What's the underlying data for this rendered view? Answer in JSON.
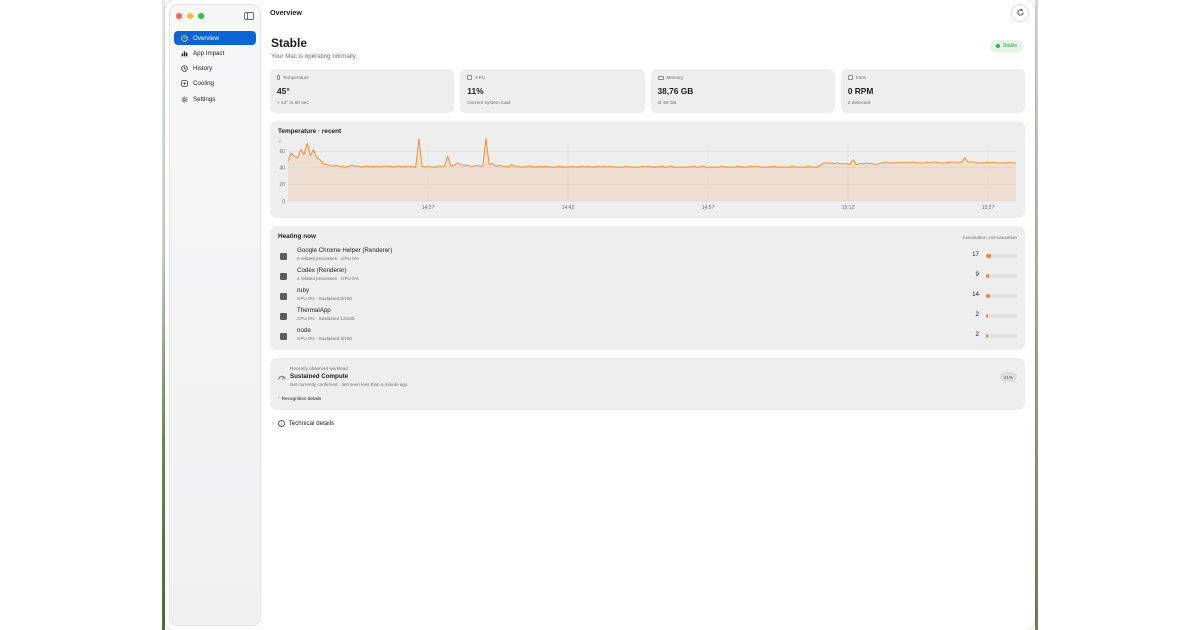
{
  "window": {
    "title": "Overview",
    "accent_color": "#0a64d6"
  },
  "sidebar": {
    "items": [
      {
        "label": "Overview",
        "icon": "gauge-icon",
        "active": true
      },
      {
        "label": "App Impact",
        "icon": "bar-chart-icon",
        "active": false
      },
      {
        "label": "History",
        "icon": "clock-icon",
        "active": false
      },
      {
        "label": "Cooling",
        "icon": "fan-icon",
        "active": false
      },
      {
        "label": "Settings",
        "icon": "gear-icon",
        "active": false
      }
    ]
  },
  "status": {
    "title": "Stable",
    "subtitle": "Your Mac is operating normally.",
    "badge": "Stable",
    "badge_color": "#2f9e45"
  },
  "cards": [
    {
      "label": "Temperature",
      "value": "45°",
      "sub": "≈ 44° in 60 sec"
    },
    {
      "label": "CPU",
      "value": "11%",
      "sub": "Current system load"
    },
    {
      "label": "Memory",
      "value": "38,76 GB",
      "sub": "of 48 GB"
    },
    {
      "label": "Fans",
      "value": "0 RPM",
      "sub": "2 detected"
    }
  ],
  "chart_panel": {
    "title": "Temperature · recent"
  },
  "chart_data": {
    "type": "area",
    "title": "Temperature · recent",
    "ylabel": "",
    "ylim": [
      0,
      70
    ],
    "yticks": [
      0,
      20,
      40,
      60
    ],
    "xtick_labels": [
      "14:27",
      "14:42",
      "14:57",
      "15:12",
      "15:27"
    ],
    "y_unit_label": "°C",
    "series": [
      {
        "color": "#f08a24",
        "values": [
          48,
          58,
          54,
          52,
          62,
          56,
          70,
          55,
          62,
          52,
          50,
          45,
          44,
          43,
          42,
          43,
          42,
          42,
          41,
          42,
          43,
          42,
          42,
          41,
          42,
          42,
          41,
          42,
          42,
          41,
          42,
          42,
          42,
          41,
          42,
          42,
          41,
          42,
          42,
          41,
          41,
          75,
          42,
          41,
          42,
          41,
          41,
          42,
          42,
          42,
          54,
          42,
          43,
          46,
          44,
          43,
          43,
          42,
          42,
          43,
          42,
          42,
          76,
          44,
          45,
          42,
          43,
          42,
          42,
          41,
          44,
          42,
          42,
          41,
          41,
          42,
          42,
          41,
          41,
          42,
          41,
          42,
          41,
          41,
          41,
          42,
          41,
          41,
          41,
          42,
          41,
          41,
          42,
          41,
          42,
          41,
          41,
          42,
          41,
          42,
          41,
          42,
          41,
          41,
          41,
          41,
          42,
          41,
          41,
          41,
          41,
          42,
          41,
          42,
          41,
          41,
          41,
          42,
          41,
          41,
          42,
          41,
          41,
          41,
          41,
          41,
          41,
          42,
          41,
          41,
          42,
          41,
          41,
          41,
          41,
          41,
          42,
          41,
          41,
          41,
          41,
          42,
          41,
          41,
          41,
          42,
          41,
          42,
          41,
          41,
          41,
          41,
          42,
          41,
          41,
          41,
          41,
          41,
          42,
          41,
          41,
          41,
          41,
          42,
          41,
          41,
          41,
          44,
          46,
          46,
          46,
          45,
          46,
          45,
          45,
          45,
          44,
          50,
          44,
          45,
          45,
          46,
          45,
          45,
          44,
          45,
          46,
          47,
          46,
          46,
          46,
          47,
          46,
          47,
          46,
          47,
          47,
          46,
          46,
          46,
          47,
          46,
          47,
          47,
          46,
          46,
          46,
          47,
          47,
          47,
          46,
          47,
          52,
          47,
          47,
          47,
          46,
          46,
          46,
          47,
          46,
          47,
          46,
          46,
          46,
          46,
          47,
          46,
          46
        ]
      }
    ]
  },
  "heating": {
    "title": "Heating now",
    "note": "Association, not causation",
    "rows": [
      {
        "name": "Google Chrome Helper (Renderer)",
        "detail": "8 related processes · CPU 0%",
        "value": "17",
        "level": 0.17
      },
      {
        "name": "Codex (Renderer)",
        "detail": "4 related processes · CPU 0%",
        "value": "9",
        "level": 0.09
      },
      {
        "name": "ruby",
        "detail": "CPU 0% · Sustained 5/100",
        "value": "14",
        "level": 0.14
      },
      {
        "name": "ThermalApp",
        "detail": "CPU 0% · Sustained 12/100",
        "value": "2",
        "level": 0.02
      },
      {
        "name": "node",
        "detail": "CPU 0% · Sustained 3/100",
        "value": "2",
        "level": 0.02
      }
    ]
  },
  "workload": {
    "caption": "Recently observed workload",
    "title": "Sustained Compute",
    "sub": "Not currently confirmed · last seen less than a minute ago",
    "confidence": "41%",
    "details_label": "Recognition details"
  },
  "technical": {
    "label": "Technical details"
  }
}
